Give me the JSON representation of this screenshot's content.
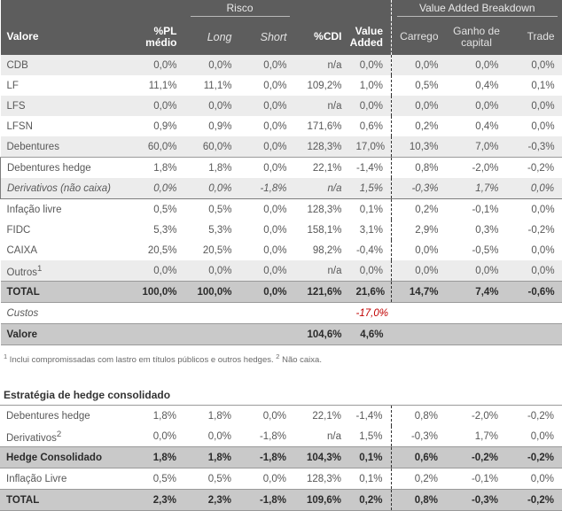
{
  "header": {
    "groups": [
      {
        "label": "Risco"
      },
      {
        "label": "Value Added Breakdown"
      }
    ],
    "columns": [
      {
        "key": "valore",
        "label": "Valore"
      },
      {
        "key": "pl",
        "label_line1": "%PL",
        "label_line2": "médio"
      },
      {
        "key": "long",
        "label": "Long"
      },
      {
        "key": "short",
        "label": "Short"
      },
      {
        "key": "cdi",
        "label": "%CDI"
      },
      {
        "key": "va",
        "label_line1": "Value",
        "label_line2": "Added"
      },
      {
        "key": "carrego",
        "label": "Carrego"
      },
      {
        "key": "ganho",
        "label_line1": "Ganho de",
        "label_line2": "capital"
      },
      {
        "key": "trade",
        "label": "Trade"
      }
    ]
  },
  "main_table": {
    "rows": [
      {
        "label": "CDB",
        "cells": [
          "0,0%",
          "0,0%",
          "0,0%",
          "n/a",
          "0,0%",
          "0,0%",
          "0,0%",
          "0,0%"
        ]
      },
      {
        "label": "LF",
        "cells": [
          "11,1%",
          "11,1%",
          "0,0%",
          "109,2%",
          "1,0%",
          "0,5%",
          "0,4%",
          "0,1%"
        ]
      },
      {
        "label": "LFS",
        "cells": [
          "0,0%",
          "0,0%",
          "0,0%",
          "n/a",
          "0,0%",
          "0,0%",
          "0,0%",
          "0,0%"
        ]
      },
      {
        "label": "LFSN",
        "cells": [
          "0,9%",
          "0,9%",
          "0,0%",
          "171,6%",
          "0,6%",
          "0,2%",
          "0,4%",
          "0,0%"
        ]
      },
      {
        "label": "Debentures",
        "cells": [
          "60,0%",
          "60,0%",
          "0,0%",
          "128,3%",
          "17,0%",
          "10,3%",
          "7,0%",
          "-0,3%"
        ]
      },
      {
        "label": "Debentures hedge",
        "cells": [
          "1,8%",
          "1,8%",
          "0,0%",
          "22,1%",
          "-1,4%",
          "0,8%",
          "-2,0%",
          "-0,2%"
        ]
      },
      {
        "label": "Derivativos (não caixa)",
        "cells": [
          "0,0%",
          "0,0%",
          "-1,8%",
          "n/a",
          "1,5%",
          "-0,3%",
          "1,7%",
          "0,0%"
        ]
      },
      {
        "label": "Infação livre",
        "cells": [
          "0,5%",
          "0,5%",
          "0,0%",
          "128,3%",
          "0,1%",
          "0,2%",
          "-0,1%",
          "0,0%"
        ]
      },
      {
        "label": "FIDC",
        "cells": [
          "5,3%",
          "5,3%",
          "0,0%",
          "158,1%",
          "3,1%",
          "2,9%",
          "0,3%",
          "-0,2%"
        ]
      },
      {
        "label": "CAIXA",
        "cells": [
          "20,5%",
          "20,5%",
          "0,0%",
          "98,2%",
          "-0,4%",
          "0,0%",
          "-0,5%",
          "0,0%"
        ]
      },
      {
        "label": "Outros",
        "label_sup": "1",
        "cells": [
          "0,0%",
          "0,0%",
          "0,0%",
          "n/a",
          "0,0%",
          "0,0%",
          "0,0%",
          "0,0%"
        ]
      }
    ],
    "total_row": {
      "label": "TOTAL",
      "cells": [
        "100,0%",
        "100,0%",
        "0,0%",
        "121,6%",
        "21,6%",
        "14,7%",
        "7,4%",
        "-0,6%"
      ]
    },
    "custos_row": {
      "label": "Custos",
      "cells": [
        "",
        "",
        "",
        "",
        "-17,0%",
        "",
        "",
        ""
      ]
    },
    "valore_row": {
      "label": "Valore",
      "cells": [
        "",
        "",
        "",
        "104,6%",
        "4,6%",
        "",
        "",
        ""
      ]
    }
  },
  "footnote": {
    "sup1": "1",
    "text1": " Inclui compromissadas com lastro em títulos públicos e outros hedges. ",
    "sup2": "2",
    "text2": " Não caixa."
  },
  "hedge_section": {
    "title": "Estratégia de hedge consolidado",
    "rows": [
      {
        "label": "Debentures hedge",
        "cells": [
          "1,8%",
          "1,8%",
          "0,0%",
          "22,1%",
          "-1,4%",
          "0,8%",
          "-2,0%",
          "-0,2%"
        ]
      },
      {
        "label": "Derivativos",
        "label_sup": "2",
        "cells": [
          "0,0%",
          "0,0%",
          "-1,8%",
          "n/a",
          "1,5%",
          "-0,3%",
          "1,7%",
          "0,0%"
        ]
      },
      {
        "label": "Hedge Consolidado",
        "emphasis": true,
        "cells": [
          "1,8%",
          "1,8%",
          "-1,8%",
          "104,3%",
          "0,1%",
          "0,6%",
          "-0,2%",
          "-0,2%"
        ]
      },
      {
        "label": "Inflação Livre",
        "cells": [
          "0,5%",
          "0,5%",
          "0,0%",
          "128,3%",
          "0,1%",
          "0,2%",
          "-0,1%",
          "0,0%"
        ]
      },
      {
        "label": "TOTAL",
        "emphasis": true,
        "cells": [
          "2,3%",
          "2,3%",
          "-1,8%",
          "109,6%",
          "0,2%",
          "0,8%",
          "-0,3%",
          "-0,2%"
        ]
      }
    ]
  },
  "colors": {
    "header_bg": "#5d5d5d",
    "stripe_bg": "#ececec",
    "emphasis_bg": "#c9c9c9",
    "negative_cost": "#c00000",
    "rule": "#9a9a9a"
  }
}
